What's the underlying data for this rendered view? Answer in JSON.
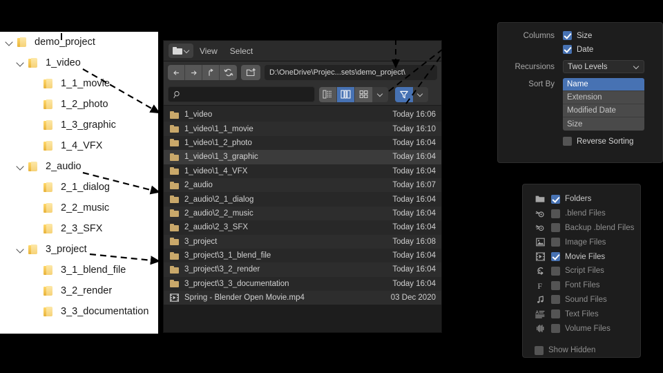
{
  "tree": {
    "items": [
      {
        "label": "demo_project",
        "depth": 0,
        "expandable": true
      },
      {
        "label": "1_video",
        "depth": 1,
        "expandable": true
      },
      {
        "label": "1_1_movie",
        "depth": 2,
        "expandable": false
      },
      {
        "label": "1_2_photo",
        "depth": 2,
        "expandable": false
      },
      {
        "label": "1_3_graphic",
        "depth": 2,
        "expandable": false
      },
      {
        "label": "1_4_VFX",
        "depth": 2,
        "expandable": false
      },
      {
        "label": "2_audio",
        "depth": 1,
        "expandable": true
      },
      {
        "label": "2_1_dialog",
        "depth": 2,
        "expandable": false
      },
      {
        "label": "2_2_music",
        "depth": 2,
        "expandable": false
      },
      {
        "label": "2_3_SFX",
        "depth": 2,
        "expandable": false
      },
      {
        "label": "3_project",
        "depth": 1,
        "expandable": true
      },
      {
        "label": "3_1_blend_file",
        "depth": 2,
        "expandable": false
      },
      {
        "label": "3_2_render",
        "depth": 2,
        "expandable": false
      },
      {
        "label": "3_3_documentation",
        "depth": 2,
        "expandable": false
      }
    ]
  },
  "file_browser": {
    "editor_type_icon": "folder-icon",
    "menus": [
      "View",
      "Select"
    ],
    "nav": {
      "back_icon": "arrow-left-icon",
      "forward_icon": "arrow-right-icon",
      "up_icon": "arrow-up-parent-icon",
      "refresh_icon": "refresh-icon",
      "new_folder_icon": "new-folder-icon"
    },
    "path": "D:\\OneDrive\\Projec...sets\\demo_project\\",
    "search": {
      "value": "",
      "placeholder": "",
      "icon": "search-icon"
    },
    "display_modes": [
      {
        "name": "vertical-list",
        "active": false
      },
      {
        "name": "horizontal-list",
        "active": true
      },
      {
        "name": "thumbnails",
        "active": false
      }
    ],
    "display_chevron_icon": "chevron-down-icon",
    "filter_toggle": {
      "icon": "funnel-icon",
      "active": true
    },
    "filter_chevron_icon": "chevron-down-icon",
    "files": [
      {
        "name": "1_video",
        "date": "Today 16:06",
        "icon": "folder-icon",
        "selected": false
      },
      {
        "name": "1_video\\1_1_movie",
        "date": "Today 16:10",
        "icon": "folder-icon",
        "selected": false
      },
      {
        "name": "1_video\\1_2_photo",
        "date": "Today 16:04",
        "icon": "folder-icon",
        "selected": false
      },
      {
        "name": "1_video\\1_3_graphic",
        "date": "Today 16:04",
        "icon": "folder-icon",
        "selected": true
      },
      {
        "name": "1_video\\1_4_VFX",
        "date": "Today 16:04",
        "icon": "folder-icon",
        "selected": false
      },
      {
        "name": "2_audio",
        "date": "Today 16:07",
        "icon": "folder-icon",
        "selected": false
      },
      {
        "name": "2_audio\\2_1_dialog",
        "date": "Today 16:04",
        "icon": "folder-icon",
        "selected": false
      },
      {
        "name": "2_audio\\2_2_music",
        "date": "Today 16:04",
        "icon": "folder-icon",
        "selected": false
      },
      {
        "name": "2_audio\\2_3_SFX",
        "date": "Today 16:04",
        "icon": "folder-icon",
        "selected": false
      },
      {
        "name": "3_project",
        "date": "Today 16:08",
        "icon": "folder-icon",
        "selected": false
      },
      {
        "name": "3_project\\3_1_blend_file",
        "date": "Today 16:04",
        "icon": "folder-icon",
        "selected": false
      },
      {
        "name": "3_project\\3_2_render",
        "date": "Today 16:04",
        "icon": "folder-icon",
        "selected": false
      },
      {
        "name": "3_project\\3_3_documentation",
        "date": "Today 16:04",
        "icon": "folder-icon",
        "selected": false
      },
      {
        "name": "Spring - Blender Open Movie.mp4",
        "date": "03 Dec 2020",
        "icon": "movie-file-icon",
        "selected": false
      }
    ]
  },
  "sort_panel": {
    "columns_label": "Columns",
    "columns": [
      {
        "label": "Size",
        "checked": true
      },
      {
        "label": "Date",
        "checked": true
      }
    ],
    "recursions_label": "Recursions",
    "recursions_value": "Two Levels",
    "sort_by_label": "Sort By",
    "sort_options": [
      {
        "label": "Name",
        "active": true
      },
      {
        "label": "Extension",
        "active": false
      },
      {
        "label": "Modified Date",
        "active": false
      },
      {
        "label": "Size",
        "active": false
      }
    ],
    "reverse_sorting": {
      "label": "Reverse Sorting",
      "checked": false
    }
  },
  "filter_panel": {
    "types": [
      {
        "label": "Folders",
        "checked": true,
        "icon": "folder-icon"
      },
      {
        "label": ".blend Files",
        "checked": false,
        "icon": "blend-file-icon"
      },
      {
        "label": "Backup .blend Files",
        "checked": false,
        "icon": "backup-blend-icon"
      },
      {
        "label": "Image Files",
        "checked": false,
        "icon": "image-file-icon"
      },
      {
        "label": "Movie Files",
        "checked": true,
        "icon": "movie-file-icon"
      },
      {
        "label": "Script Files",
        "checked": false,
        "icon": "script-file-icon"
      },
      {
        "label": "Font Files",
        "checked": false,
        "icon": "font-file-icon"
      },
      {
        "label": "Sound Files",
        "checked": false,
        "icon": "sound-file-icon"
      },
      {
        "label": "Text Files",
        "checked": false,
        "icon": "text-file-icon"
      },
      {
        "label": "Volume Files",
        "checked": false,
        "icon": "volume-file-icon"
      }
    ],
    "show_hidden": {
      "label": "Show Hidden",
      "checked": false
    }
  },
  "colors": {
    "accent_blue": "#4772b3",
    "folder_yellow": "#c9a86a",
    "panel_bg": "#1d1d1d",
    "list_bg": "#282828"
  }
}
